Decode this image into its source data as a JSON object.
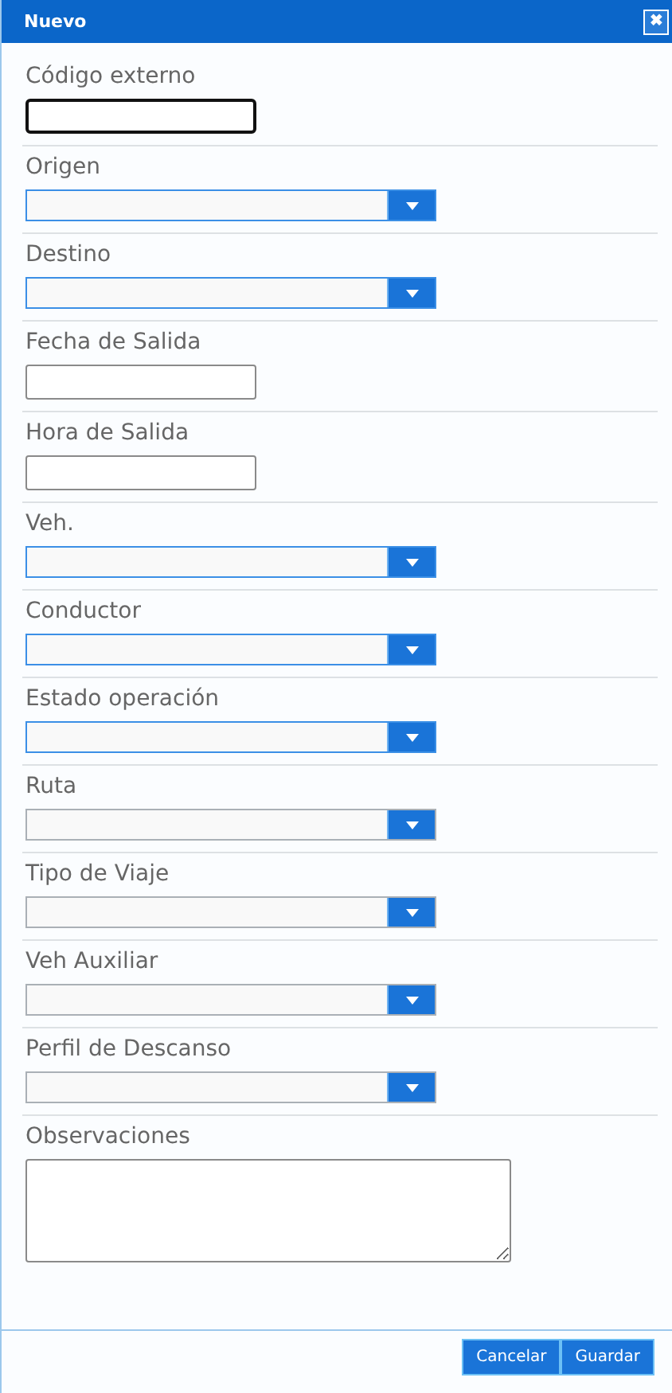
{
  "window": {
    "title": "Nuevo",
    "close_icon": "✖"
  },
  "fields": [
    {
      "label": "Código externo",
      "kind": "text",
      "focused": true,
      "highlighted": false
    },
    {
      "label": "Origen",
      "kind": "select",
      "focused": false,
      "highlighted": true
    },
    {
      "label": "Destino",
      "kind": "select",
      "focused": false,
      "highlighted": true
    },
    {
      "label": "Fecha de Salida",
      "kind": "text",
      "focused": false,
      "highlighted": false
    },
    {
      "label": "Hora de Salida",
      "kind": "text",
      "focused": false,
      "highlighted": false
    },
    {
      "label": "Veh.",
      "kind": "select",
      "focused": false,
      "highlighted": true
    },
    {
      "label": "Conductor",
      "kind": "select",
      "focused": false,
      "highlighted": true
    },
    {
      "label": "Estado operación",
      "kind": "select",
      "focused": false,
      "highlighted": true
    },
    {
      "label": "Ruta",
      "kind": "select",
      "focused": false,
      "highlighted": false
    },
    {
      "label": "Tipo de Viaje",
      "kind": "select",
      "focused": false,
      "highlighted": false
    },
    {
      "label": "Veh Auxiliar",
      "kind": "select",
      "focused": false,
      "highlighted": false
    },
    {
      "label": "Perfil de Descanso",
      "kind": "select",
      "focused": false,
      "highlighted": false
    },
    {
      "label": "Observaciones",
      "kind": "textarea",
      "focused": false,
      "highlighted": false
    }
  ],
  "buttons": [
    "Cancelar",
    "Guardar"
  ]
}
